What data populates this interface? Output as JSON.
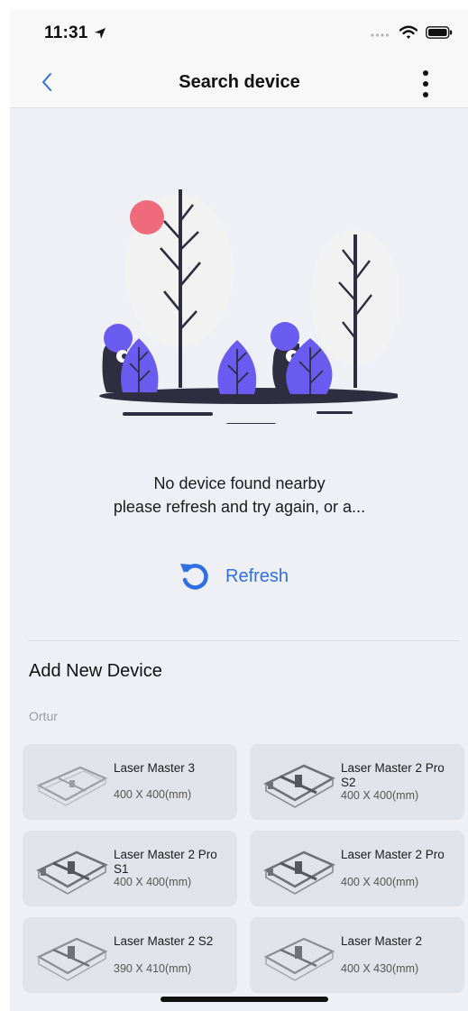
{
  "status_bar": {
    "time": "11:31"
  },
  "nav": {
    "title": "Search device"
  },
  "empty_state": {
    "line1": "No device found nearby",
    "line2": "please refresh and try again, or a..."
  },
  "refresh": {
    "label": "Refresh"
  },
  "section": {
    "title": "Add New Device",
    "brand": "Ortur"
  },
  "devices": [
    {
      "name": "Laser Master 3",
      "size": "400 X 400(mm)"
    },
    {
      "name": "Laser Master 2 Pro S2",
      "size": "400 X 400(mm)"
    },
    {
      "name": "Laser Master 2 Pro S1",
      "size": "400 X 400(mm)"
    },
    {
      "name": "Laser Master 2 Pro",
      "size": "400 X 400(mm)"
    },
    {
      "name": "Laser Master 2 S2",
      "size": "390 X 410(mm)"
    },
    {
      "name": "Laser Master 2",
      "size": "400 X 430(mm)"
    }
  ],
  "colors": {
    "accent": "#2f6fe4",
    "illustration_purple": "#6a5cf0",
    "illustration_coral": "#ef6b7c",
    "illustration_dark": "#2f2e41",
    "background": "#eef0f6",
    "card": "#e1e3ea"
  },
  "icons": {
    "back": "chevron-left-icon",
    "more": "vertical-dots-icon",
    "refresh": "refresh-icon",
    "location": "location-arrow-icon",
    "wifi": "wifi-icon",
    "battery": "battery-icon",
    "signal": "signal-dots-icon"
  }
}
